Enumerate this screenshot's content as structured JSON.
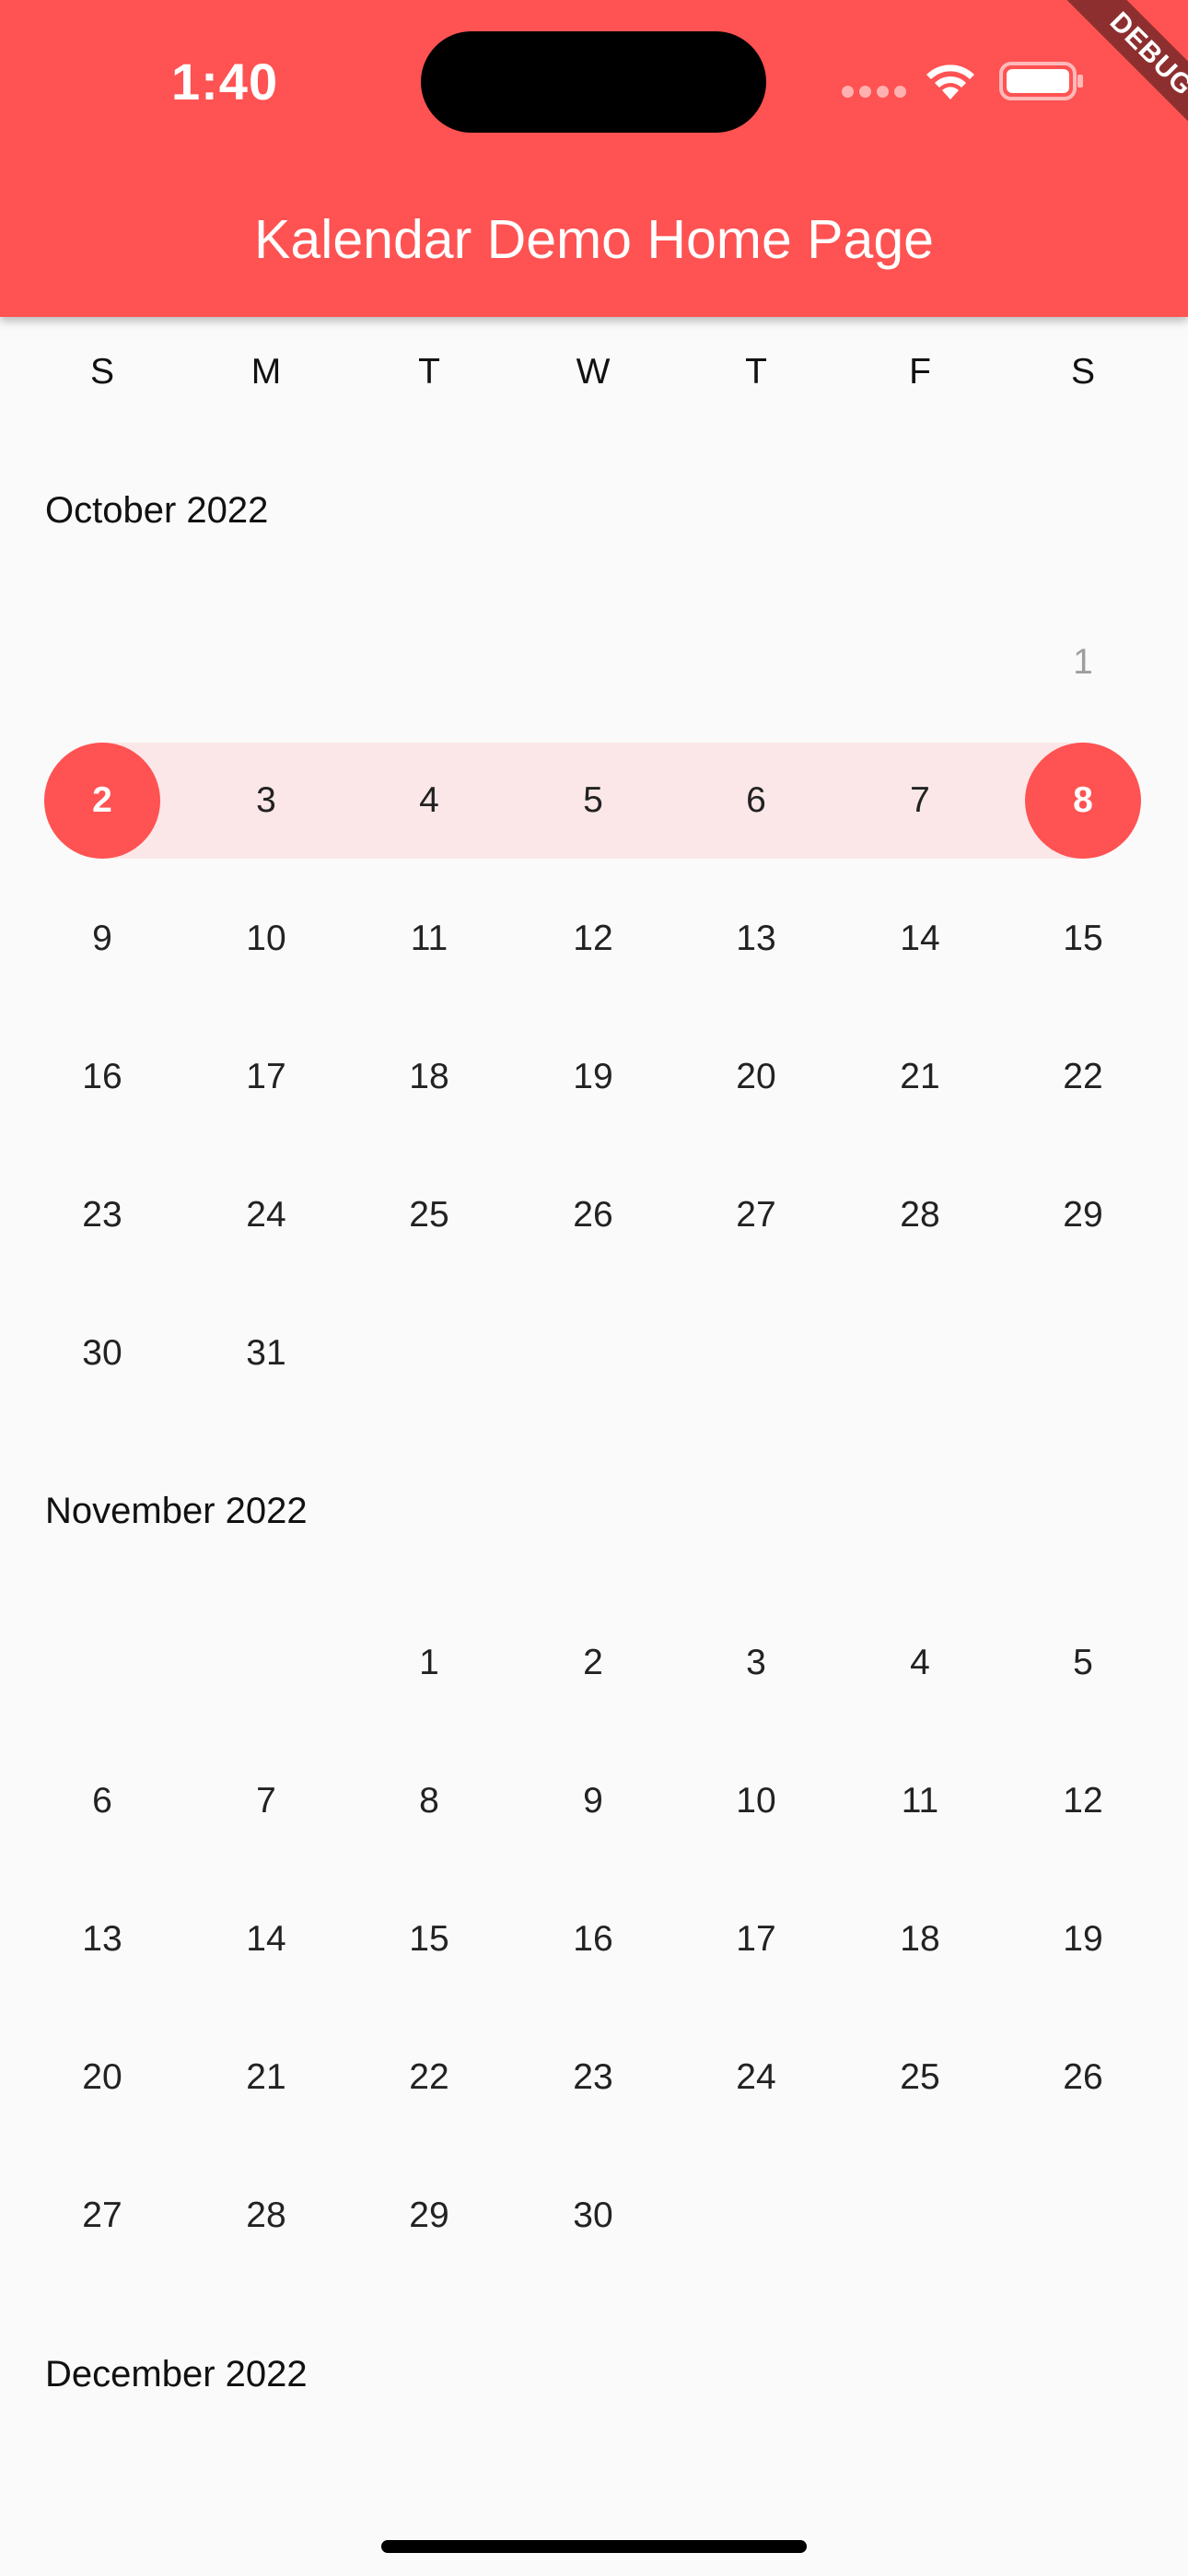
{
  "status_bar": {
    "time": "1:40"
  },
  "debug_banner": "DEBUG",
  "app_bar": {
    "title": "Kalendar Demo Home Page",
    "color": "#FF5252"
  },
  "weekdays": [
    "S",
    "M",
    "T",
    "W",
    "T",
    "F",
    "S"
  ],
  "colors": {
    "accent": "#FF5252",
    "range_highlight": "#FBE7E7",
    "muted_day": "#9E9E9E"
  },
  "selection": {
    "month": "October 2022",
    "start_day": "2",
    "end_day": "8"
  },
  "months": [
    {
      "title": "October 2022",
      "weeks": [
        [
          "",
          "",
          "",
          "",
          "",
          "",
          "1"
        ],
        [
          "2",
          "3",
          "4",
          "5",
          "6",
          "7",
          "8"
        ],
        [
          "9",
          "10",
          "11",
          "12",
          "13",
          "14",
          "15"
        ],
        [
          "16",
          "17",
          "18",
          "19",
          "20",
          "21",
          "22"
        ],
        [
          "23",
          "24",
          "25",
          "26",
          "27",
          "28",
          "29"
        ],
        [
          "30",
          "31",
          "",
          "",
          "",
          "",
          ""
        ]
      ]
    },
    {
      "title": "November 2022",
      "weeks": [
        [
          "",
          "",
          "1",
          "2",
          "3",
          "4",
          "5"
        ],
        [
          "6",
          "7",
          "8",
          "9",
          "10",
          "11",
          "12"
        ],
        [
          "13",
          "14",
          "15",
          "16",
          "17",
          "18",
          "19"
        ],
        [
          "20",
          "21",
          "22",
          "23",
          "24",
          "25",
          "26"
        ],
        [
          "27",
          "28",
          "29",
          "30",
          "",
          "",
          ""
        ]
      ]
    },
    {
      "title": "December 2022",
      "weeks": []
    }
  ]
}
